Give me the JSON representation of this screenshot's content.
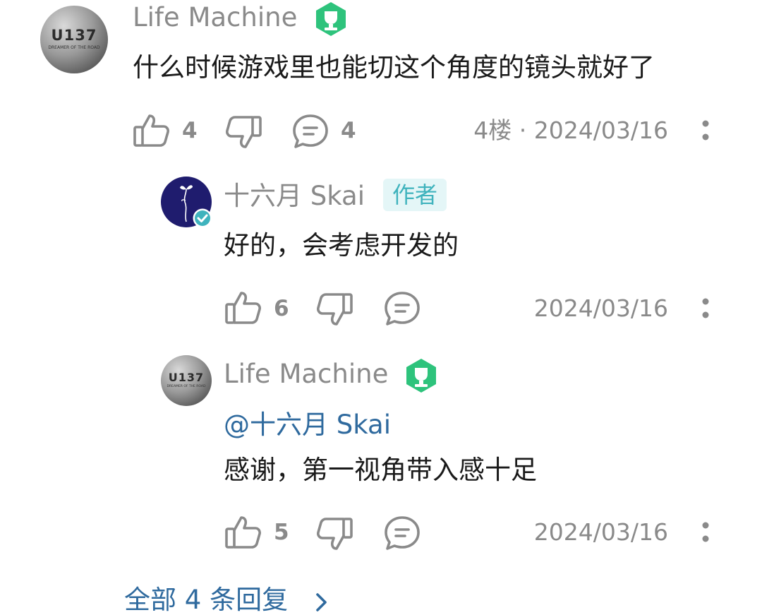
{
  "colors": {
    "username_gray": "#8a8a8a",
    "text": "#1a1a1a",
    "link_blue": "#2f6a9e",
    "badge_green": "#2ec37c",
    "author_tag_bg": "#e4f6f7",
    "author_tag_text": "#3fb3bd",
    "author_avatar_bg": "#1f1c6e"
  },
  "comment": {
    "avatar_text": "U137",
    "avatar_sub": "DREAMER OF THE ROAD",
    "avatar_icon": "u137-avatar",
    "username": "Life Machine",
    "badge_icon": "trophy-badge-icon",
    "text": "什么时候游戏里也能切这个角度的镜头就好了",
    "likes": "4",
    "replies_count": "4",
    "floor": "4楼",
    "separator": "·",
    "date": "2024/03/16"
  },
  "replies": [
    {
      "username": "十六月 Skai",
      "author_tag": "作者",
      "verified_icon": "verified-check-icon",
      "text": "好的，会考虑开发的",
      "likes": "6",
      "date": "2024/03/16"
    },
    {
      "avatar_text": "U137",
      "avatar_sub": "DREAMER OF THE ROAD",
      "username": "Life Machine",
      "mention": "@十六月 Skai",
      "text": "感谢，第一视角带入感十足",
      "likes": "5",
      "date": "2024/03/16"
    }
  ],
  "more_replies_label": "全部 4 条回复"
}
